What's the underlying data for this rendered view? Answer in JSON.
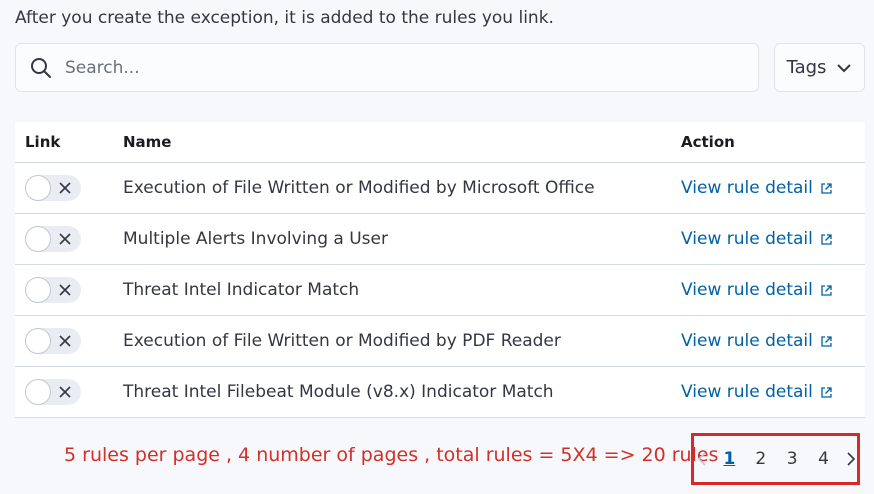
{
  "intro_text": "After you create the exception, it is added to the rules you link.",
  "search": {
    "placeholder": "Search...",
    "value": ""
  },
  "tags_filter": {
    "label": "Tags",
    "icon": "chevron-down-icon"
  },
  "table": {
    "columns": [
      "Link",
      "Name",
      "Action"
    ],
    "rows": [
      {
        "name": "Execution of File Written or Modified by Microsoft Office",
        "linked": false,
        "action": "View rule detail"
      },
      {
        "name": "Multiple Alerts Involving a User",
        "linked": false,
        "action": "View rule detail"
      },
      {
        "name": "Threat Intel Indicator Match",
        "linked": false,
        "action": "View rule detail"
      },
      {
        "name": "Execution of File Written or Modified by PDF Reader",
        "linked": false,
        "action": "View rule detail"
      },
      {
        "name": "Threat Intel Filebeat Module (v8.x) Indicator Match",
        "linked": false,
        "action": "View rule detail"
      }
    ]
  },
  "annotation": "5 rules per page , 4 number of pages , total rules = 5X4 => 20 rules",
  "pagination": {
    "pages": [
      "1",
      "2",
      "3",
      "4"
    ],
    "current": "1"
  },
  "colors": {
    "link": "#0061a6",
    "annotation": "#d22f27",
    "highlight_box": "#d42a2a",
    "background": "#f7f8fc"
  }
}
